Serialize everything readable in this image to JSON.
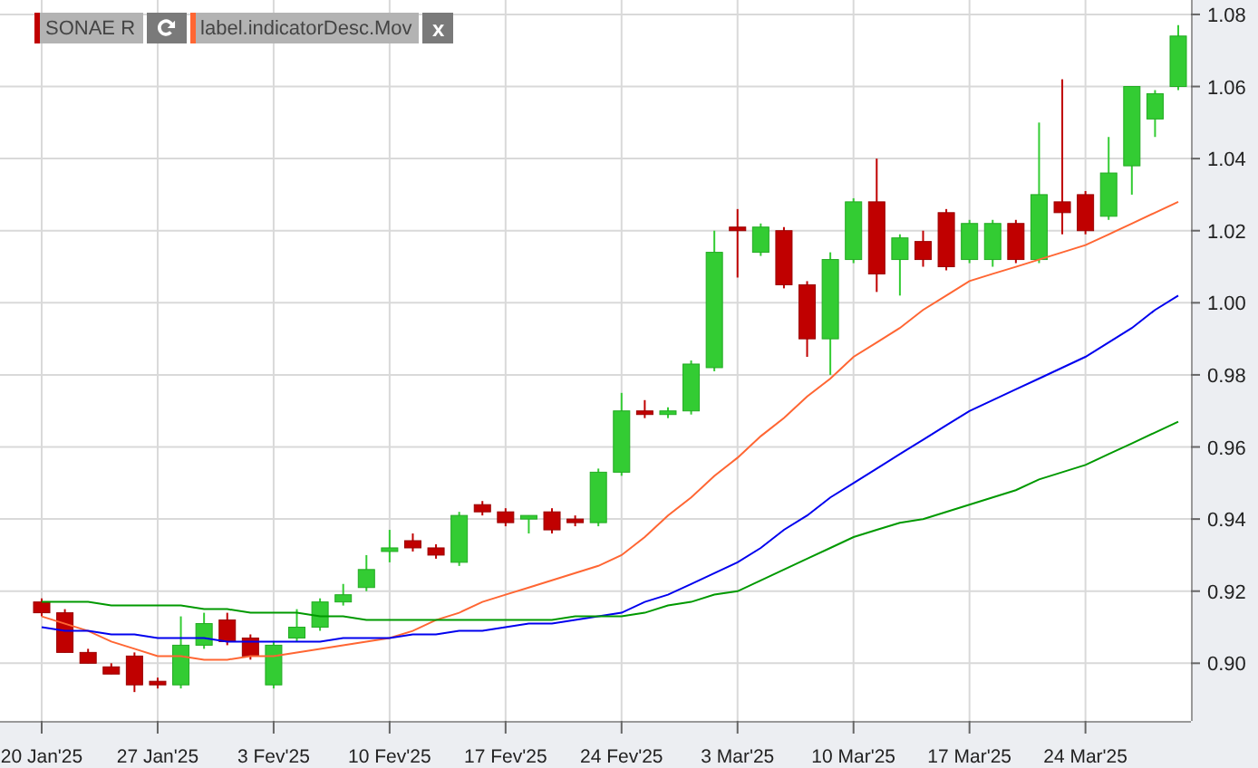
{
  "legend": [
    {
      "label": "SONAE R",
      "color": "#c00000",
      "refresh_button": true
    },
    {
      "label": "label.indicatorDesc.Mov",
      "color": "#ff6633",
      "close_button": "x"
    }
  ],
  "chart_data": {
    "type": "candlestick",
    "grid": true,
    "categories": [
      "20 Jan'25",
      null,
      null,
      null,
      null,
      "27 Jan'25",
      null,
      null,
      null,
      null,
      "3 Fev'25",
      null,
      null,
      null,
      null,
      "10 Fev'25",
      null,
      null,
      null,
      null,
      "17 Fev'25",
      null,
      null,
      null,
      null,
      "24 Fev'25",
      null,
      null,
      null,
      null,
      "3 Mar'25",
      null,
      null,
      null,
      null,
      "10 Mar'25",
      null,
      null,
      null,
      null,
      "17 Mar'25",
      null,
      null,
      null,
      null,
      "24 Mar'25",
      null,
      null,
      null,
      null
    ],
    "ylim": [
      0.884,
      1.084
    ],
    "yticks": [
      {
        "value": 0.9,
        "label": "0.90"
      },
      {
        "value": 0.92,
        "label": "0.92"
      },
      {
        "value": 0.94,
        "label": "0.94"
      },
      {
        "value": 0.96,
        "label": "0.96"
      },
      {
        "value": 0.98,
        "label": "0.98"
      },
      {
        "value": 1.0,
        "label": "1.00"
      },
      {
        "value": 1.02,
        "label": "1.02"
      },
      {
        "value": 1.04,
        "label": "1.04"
      },
      {
        "value": 1.06,
        "label": "1.06"
      },
      {
        "value": 1.08,
        "label": "1.08"
      }
    ],
    "ohlc": [
      [
        0.917,
        0.918,
        0.913,
        0.914
      ],
      [
        0.914,
        0.915,
        0.903,
        0.903
      ],
      [
        0.903,
        0.904,
        0.9,
        0.9
      ],
      [
        0.899,
        0.9,
        0.897,
        0.897
      ],
      [
        0.902,
        0.903,
        0.892,
        0.894
      ],
      [
        0.895,
        0.896,
        0.893,
        0.894
      ],
      [
        0.894,
        0.913,
        0.893,
        0.905
      ],
      [
        0.905,
        0.914,
        0.904,
        0.911
      ],
      [
        0.912,
        0.914,
        0.905,
        0.906
      ],
      [
        0.907,
        0.908,
        0.901,
        0.902
      ],
      [
        0.894,
        0.906,
        0.893,
        0.905
      ],
      [
        0.907,
        0.915,
        0.906,
        0.91
      ],
      [
        0.91,
        0.918,
        0.909,
        0.917
      ],
      [
        0.917,
        0.922,
        0.916,
        0.919
      ],
      [
        0.921,
        0.93,
        0.92,
        0.926
      ],
      [
        0.931,
        0.937,
        0.928,
        0.932
      ],
      [
        0.934,
        0.936,
        0.931,
        0.932
      ],
      [
        0.932,
        0.933,
        0.929,
        0.93
      ],
      [
        0.928,
        0.942,
        0.927,
        0.941
      ],
      [
        0.944,
        0.945,
        0.941,
        0.942
      ],
      [
        0.942,
        0.943,
        0.938,
        0.939
      ],
      [
        0.94,
        0.941,
        0.936,
        0.941
      ],
      [
        0.942,
        0.943,
        0.936,
        0.937
      ],
      [
        0.94,
        0.941,
        0.938,
        0.939
      ],
      [
        0.939,
        0.954,
        0.938,
        0.953
      ],
      [
        0.953,
        0.975,
        0.952,
        0.97
      ],
      [
        0.97,
        0.973,
        0.968,
        0.969
      ],
      [
        0.969,
        0.971,
        0.968,
        0.97
      ],
      [
        0.97,
        0.984,
        0.969,
        0.983
      ],
      [
        0.982,
        1.02,
        0.981,
        1.014
      ],
      [
        1.021,
        1.026,
        1.007,
        1.02
      ],
      [
        1.014,
        1.022,
        1.013,
        1.021
      ],
      [
        1.02,
        1.021,
        1.004,
        1.005
      ],
      [
        1.005,
        1.006,
        0.985,
        0.99
      ],
      [
        0.99,
        1.014,
        0.98,
        1.012
      ],
      [
        1.012,
        1.029,
        1.011,
        1.028
      ],
      [
        1.028,
        1.04,
        1.003,
        1.008
      ],
      [
        1.012,
        1.019,
        1.002,
        1.018
      ],
      [
        1.017,
        1.02,
        1.01,
        1.012
      ],
      [
        1.025,
        1.026,
        1.009,
        1.01
      ],
      [
        1.012,
        1.023,
        1.011,
        1.022
      ],
      [
        1.012,
        1.023,
        1.01,
        1.022
      ],
      [
        1.022,
        1.023,
        1.011,
        1.012
      ],
      [
        1.012,
        1.05,
        1.011,
        1.03
      ],
      [
        1.028,
        1.062,
        1.019,
        1.025
      ],
      [
        1.03,
        1.031,
        1.019,
        1.02
      ],
      [
        1.024,
        1.046,
        1.023,
        1.036
      ],
      [
        1.038,
        1.06,
        1.03,
        1.06
      ],
      [
        1.051,
        1.059,
        1.046,
        1.058
      ],
      [
        1.06,
        1.077,
        1.059,
        1.074
      ]
    ],
    "series": [
      {
        "type": "line",
        "color": "#ff6633",
        "values": [
          0.913,
          0.911,
          0.909,
          0.906,
          0.904,
          0.902,
          0.902,
          0.901,
          0.901,
          0.902,
          0.902,
          0.903,
          0.904,
          0.905,
          0.906,
          0.907,
          0.909,
          0.912,
          0.914,
          0.917,
          0.919,
          0.921,
          0.923,
          0.925,
          0.927,
          0.93,
          0.935,
          0.941,
          0.946,
          0.952,
          0.957,
          0.963,
          0.968,
          0.974,
          0.979,
          0.985,
          0.989,
          0.993,
          0.998,
          1.002,
          1.006,
          1.008,
          1.01,
          1.012,
          1.014,
          1.016,
          1.019,
          1.022,
          1.025,
          1.028
        ]
      },
      {
        "type": "line",
        "color": "#0000ee",
        "values": [
          0.91,
          0.909,
          0.909,
          0.908,
          0.908,
          0.907,
          0.907,
          0.907,
          0.906,
          0.906,
          0.906,
          0.906,
          0.906,
          0.907,
          0.907,
          0.907,
          0.908,
          0.908,
          0.909,
          0.909,
          0.91,
          0.911,
          0.911,
          0.912,
          0.913,
          0.914,
          0.917,
          0.919,
          0.922,
          0.925,
          0.928,
          0.932,
          0.937,
          0.941,
          0.946,
          0.95,
          0.954,
          0.958,
          0.962,
          0.966,
          0.97,
          0.973,
          0.976,
          0.979,
          0.982,
          0.985,
          0.989,
          0.993,
          0.998,
          1.002
        ]
      },
      {
        "type": "line",
        "color": "#009900",
        "values": [
          0.917,
          0.917,
          0.917,
          0.916,
          0.916,
          0.916,
          0.916,
          0.915,
          0.915,
          0.914,
          0.914,
          0.914,
          0.913,
          0.913,
          0.912,
          0.912,
          0.912,
          0.912,
          0.912,
          0.912,
          0.912,
          0.912,
          0.912,
          0.913,
          0.913,
          0.913,
          0.914,
          0.916,
          0.917,
          0.919,
          0.92,
          0.923,
          0.926,
          0.929,
          0.932,
          0.935,
          0.937,
          0.939,
          0.94,
          0.942,
          0.944,
          0.946,
          0.948,
          0.951,
          0.953,
          0.955,
          0.958,
          0.961,
          0.964,
          0.967
        ]
      }
    ]
  }
}
